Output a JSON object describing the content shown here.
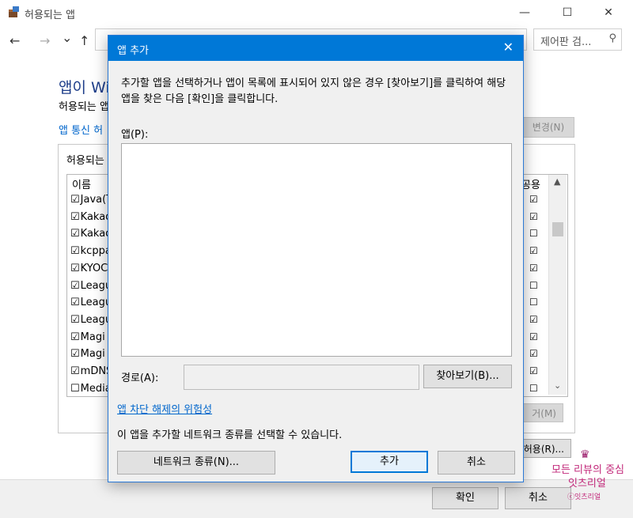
{
  "window": {
    "title": "허용되는 앱",
    "minimize": "—",
    "maximize": "☐",
    "close": "✕"
  },
  "nav": {
    "back": "←",
    "forward": "→",
    "dropdown": "⌄",
    "up": "↑",
    "search_placeholder": "제어판 검...",
    "search_icon": "⚲"
  },
  "main": {
    "heading": "앱이 Wi",
    "subtext": "허용되는 앱",
    "link": "앱 통신 허",
    "change_button": "변경(N)",
    "group_title": "허용되는",
    "col_name": "이름",
    "col_public": "공용",
    "rows": [
      {
        "name": "Java(T",
        "checked": "☑",
        "public": "☑"
      },
      {
        "name": "Kakao",
        "checked": "☑",
        "public": "☑"
      },
      {
        "name": "Kakao",
        "checked": "☑",
        "public": "☐"
      },
      {
        "name": "kcppa",
        "checked": "☑",
        "public": "☑"
      },
      {
        "name": "KYOC",
        "checked": "☑",
        "public": "☑"
      },
      {
        "name": "Leagu",
        "checked": "☑",
        "public": "☐"
      },
      {
        "name": "Leagu",
        "checked": "☑",
        "public": "☐"
      },
      {
        "name": "Leagu",
        "checked": "☑",
        "public": "☑"
      },
      {
        "name": "Magi",
        "checked": "☑",
        "public": "☑"
      },
      {
        "name": "Magi",
        "checked": "☑",
        "public": "☑"
      },
      {
        "name": "mDNS",
        "checked": "☑",
        "public": "☑"
      },
      {
        "name": "Media",
        "checked": "☐",
        "public": "☐"
      }
    ],
    "scroll_up": "▲",
    "scroll_down": "⌄",
    "remove_button": "거(M)",
    "allow_button": "허용(R)...",
    "ok_button": "확인",
    "cancel_button": "취소"
  },
  "watermark": {
    "line1": "모든 리뷰의 중심",
    "line2": "잇츠리얼",
    "line3": "ⓒ잇츠리얼",
    "crown": "♛"
  },
  "dialog": {
    "title": "앱 추가",
    "close": "✕",
    "description": "추가할 앱을 선택하거나 앱이 목록에 표시되어 있지 않은 경우 [찾아보기]를 클릭하여 해당 앱을 찾은 다음 [확인]을 클릭합니다.",
    "app_label": "앱(P):",
    "path_label": "경로(A):",
    "path_value": "",
    "browse_button": "찾아보기(B)...",
    "risk_link": "앱 차단 해제의 위험성",
    "network_text": "이 앱을 추가할 네트워크 종류를 선택할 수 있습니다.",
    "network_button": "네트워크 종류(N)...",
    "add_button": "추가",
    "cancel_button": "취소"
  },
  "colors": {
    "title_bar": "#0078d7",
    "link": "#0066cc",
    "heading": "#1e3e8a",
    "watermark": "#c2287a"
  }
}
